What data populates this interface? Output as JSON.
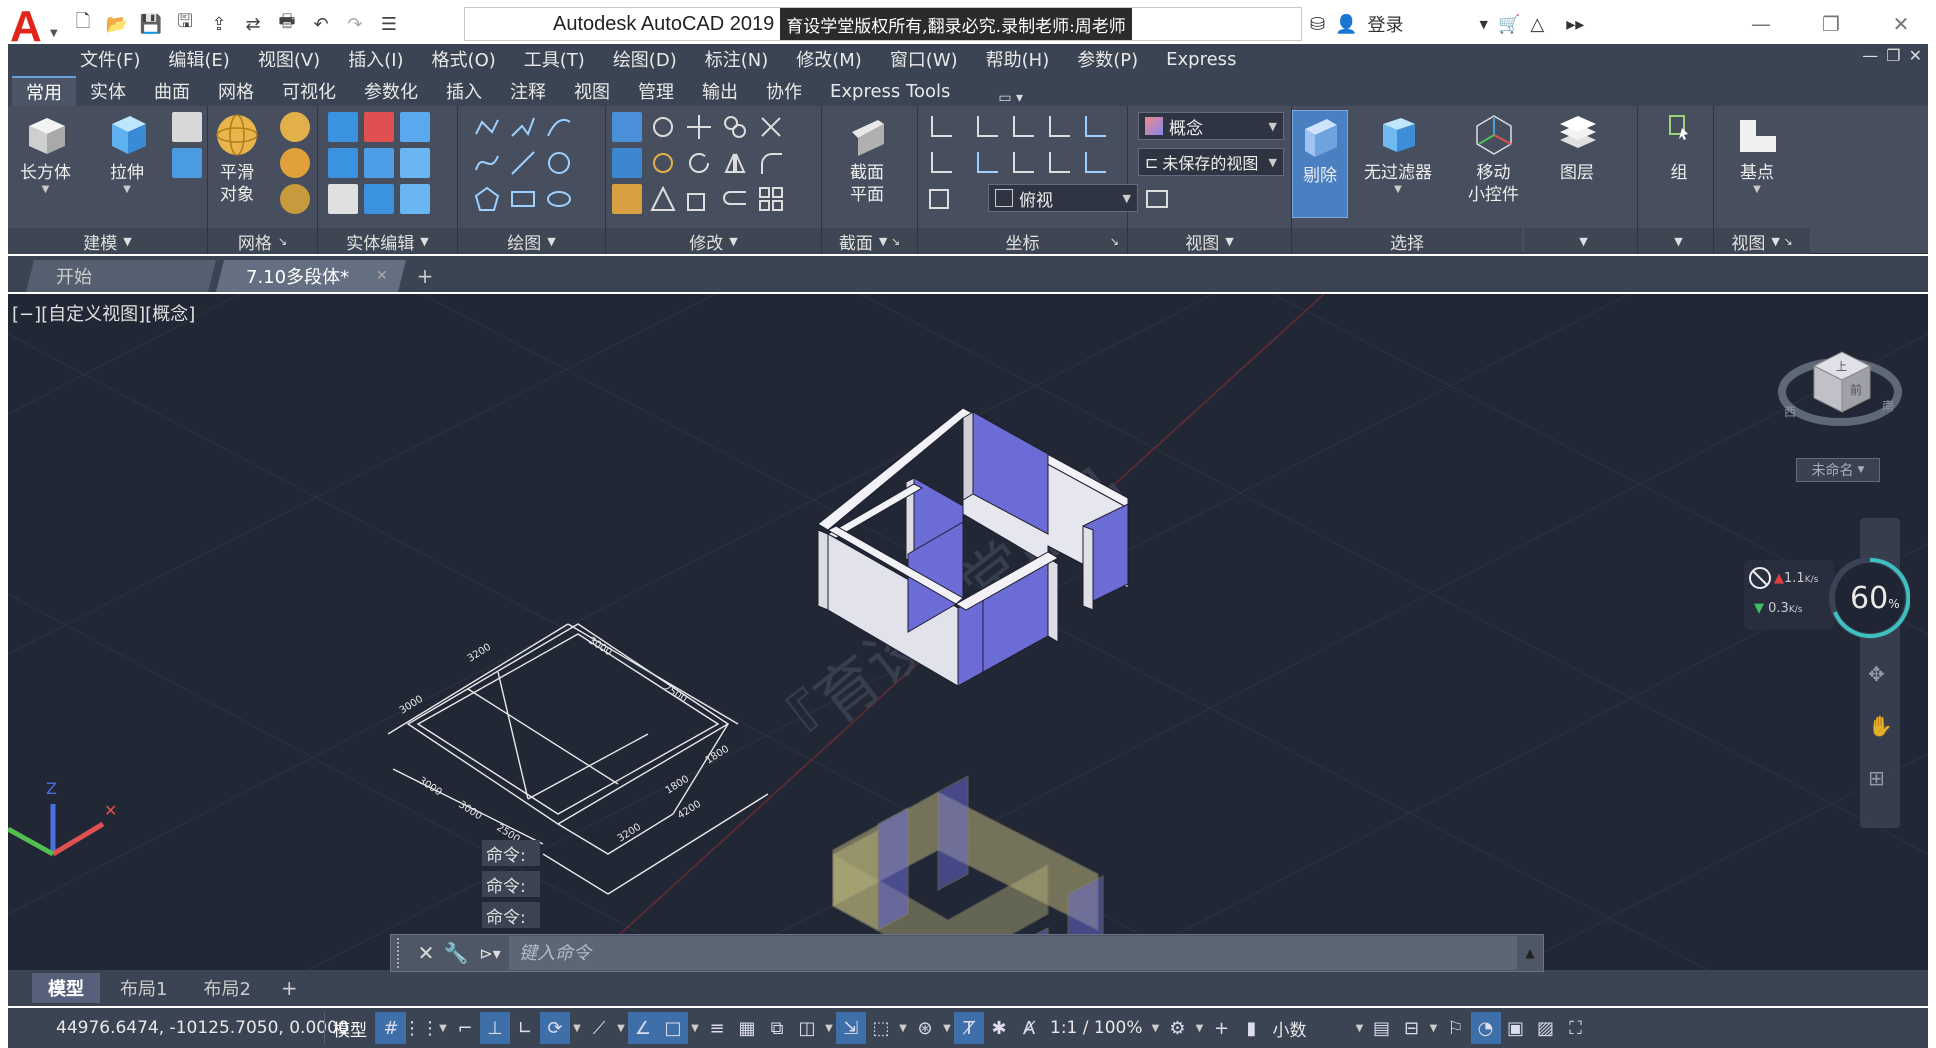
{
  "app": {
    "title": "Autodesk AutoCAD 2019",
    "watermark_strip": "育设学堂版权所有,翻录必究.录制老师:周老师",
    "login": "登录"
  },
  "menus": [
    "文件(F)",
    "编辑(E)",
    "视图(V)",
    "插入(I)",
    "格式(O)",
    "工具(T)",
    "绘图(D)",
    "标注(N)",
    "修改(M)",
    "窗口(W)",
    "帮助(H)",
    "参数(P)",
    "Express"
  ],
  "ribbon_tabs": [
    "常用",
    "实体",
    "曲面",
    "网格",
    "可视化",
    "参数化",
    "插入",
    "注释",
    "视图",
    "管理",
    "输出",
    "协作",
    "Express Tools"
  ],
  "ribbon": {
    "box_label": "长方体",
    "extrude_label": "拉伸",
    "smooth_label_1": "平滑",
    "smooth_label_2": "对象",
    "section_label_1": "截面",
    "section_label_2": "平面",
    "visual_style": "概念",
    "unsaved_view": "未保存的视图",
    "top_view": "俯视",
    "cull_label": "剔除",
    "no_filter_label": "无过滤器",
    "gizmo_label_1": "移动",
    "gizmo_label_2": "小控件",
    "layers_label": "图层",
    "group_label": "组",
    "basepoint_label": "基点",
    "panels": {
      "modeling": "建模",
      "mesh": "网格",
      "solid_edit": "实体编辑",
      "draw": "绘图",
      "modify": "修改",
      "section": "截面",
      "coordinates": "坐标",
      "view": "视图",
      "selection": "选择",
      "view2": "视图"
    }
  },
  "file_tabs": [
    "开始",
    "7.10多段体*"
  ],
  "viewport": {
    "label": "[−][自定义视图][概念]",
    "viewcube_name": "未命名",
    "viewcube_faces": {
      "top": "上",
      "front": "前",
      "west": "西",
      "south": "南"
    },
    "net_up": "1.1",
    "net_down": "0.3",
    "net_unit": "K/s",
    "net_percent": "60",
    "percent_sign": "%",
    "diagonal_watermark": "『育设学堂出品",
    "ucs_z": "Z",
    "command_history": [
      "命令:",
      "命令:",
      "命令:"
    ],
    "dimensions": [
      "3200",
      "3000",
      "3000",
      "2500",
      "1800",
      "1800",
      "3000",
      "3000",
      "2500",
      "3200",
      "4200"
    ]
  },
  "command_line": {
    "placeholder": "键入命令"
  },
  "layout_tabs": [
    "模型",
    "布局1",
    "布局2"
  ],
  "status": {
    "coords": "44976.6474, -10125.7050, 0.0000",
    "model": "模型",
    "scale": "1:1 / 100%",
    "units": "小数"
  },
  "colors": {
    "accent_blue": "#3e6fa8",
    "viewport_bg": "#212734",
    "wall_face_white": "#e2e2ea",
    "wall_face_blue": "#6c6cd6",
    "ghost_wall": "#b8b27a"
  }
}
